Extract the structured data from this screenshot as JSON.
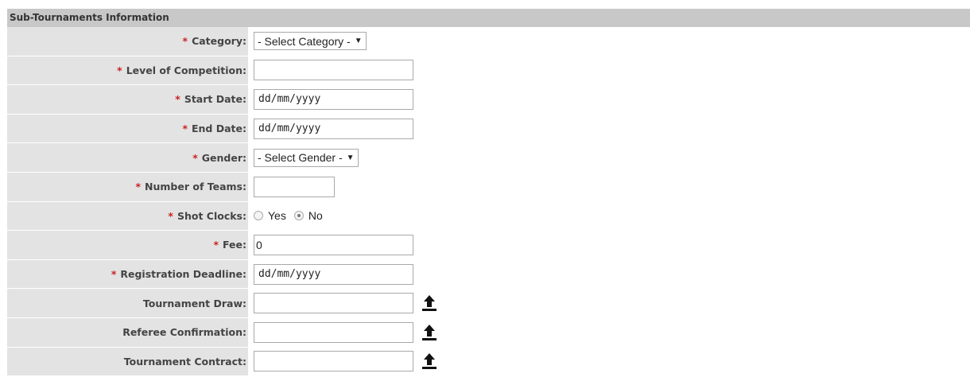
{
  "section": {
    "title": "Sub-Tournaments Information"
  },
  "required_marker": "*",
  "fields": {
    "category": {
      "label": "Category:",
      "value": "- Select Category -",
      "caret": "▼"
    },
    "level": {
      "label": "Level of Competition:",
      "value": ""
    },
    "start_date": {
      "label": "Start Date:",
      "value": "dd/mm/yyyy"
    },
    "end_date": {
      "label": "End Date:",
      "value": "dd/mm/yyyy"
    },
    "gender": {
      "label": "Gender:",
      "value": "- Select Gender -",
      "caret": "▼"
    },
    "teams": {
      "label": "Number of Teams:",
      "value": ""
    },
    "shot_clocks": {
      "label": "Shot Clocks:",
      "options": [
        "Yes",
        "No"
      ],
      "selected": "No"
    },
    "fee": {
      "label": "Fee:",
      "value": "0"
    },
    "deadline": {
      "label": "Registration Deadline:",
      "value": "dd/mm/yyyy"
    },
    "draw": {
      "label": "Tournament Draw:",
      "value": "",
      "icon": "upload-icon"
    },
    "referee": {
      "label": "Referee Confirmation:",
      "value": "",
      "icon": "upload-icon"
    },
    "contract": {
      "label": "Tournament Contract:",
      "value": "",
      "icon": "upload-icon"
    }
  }
}
